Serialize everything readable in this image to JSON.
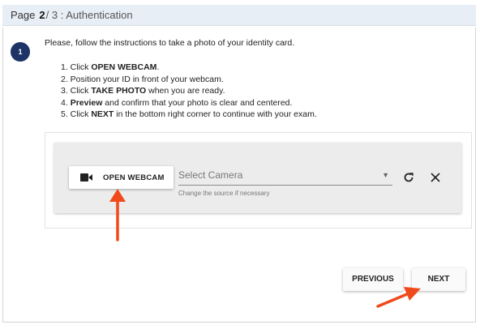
{
  "header": {
    "page_label": "Page",
    "current_page": "2",
    "separator": "/",
    "total_pages": "3",
    "section": ": Authentication"
  },
  "step": {
    "number": "1",
    "intro": "Please, follow the instructions to take a photo of your identity card.",
    "instructions": [
      {
        "prefix": "1. Click ",
        "bold": "OPEN WEBCAM",
        "suffix": "."
      },
      {
        "prefix": "2. Position your ID in front of your webcam.",
        "bold": "",
        "suffix": ""
      },
      {
        "prefix": "3. Click ",
        "bold": "TAKE PHOTO",
        "suffix": " when you are ready."
      },
      {
        "prefix": "4. ",
        "bold": "Preview",
        "suffix": " and confirm that your photo is clear and centered."
      },
      {
        "prefix": "5. Click ",
        "bold": "NEXT",
        "suffix": " in the bottom right corner to continue with your exam."
      }
    ]
  },
  "webcam": {
    "open_label": "OPEN WEBCAM",
    "icon": "videocam-icon",
    "camera_select_placeholder": "Select Camera",
    "camera_select_helper": "Change the source if necessary",
    "refresh_icon": "refresh-icon",
    "close_icon": "close-icon"
  },
  "navigation": {
    "previous_label": "PREVIOUS",
    "next_label": "NEXT"
  },
  "colors": {
    "header_bg": "#e8eef6",
    "badge": "#1e3466",
    "annotation_arrow": "#f04a1c"
  }
}
